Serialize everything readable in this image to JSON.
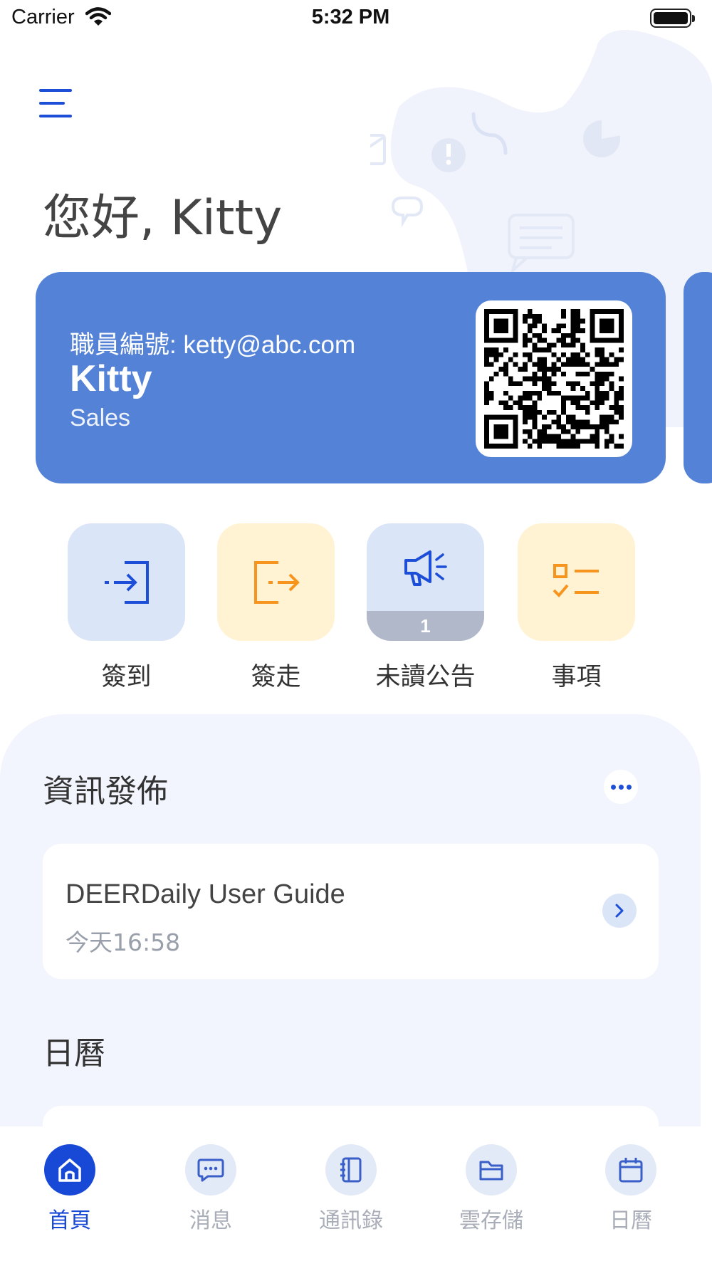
{
  "status_bar": {
    "carrier": "Carrier",
    "time": "5:32 PM"
  },
  "header": {
    "menu_icon": "menu-icon",
    "greeting": "您好, Kitty"
  },
  "id_card": {
    "employee_id": "職員編號: ketty@abc.com",
    "name": "Kitty",
    "department": "Sales",
    "qr_icon": "qr-code"
  },
  "quick_actions": [
    {
      "label": "簽到",
      "icon": "check-in-icon"
    },
    {
      "label": "簽走",
      "icon": "check-out-icon"
    },
    {
      "label": "未讀公告",
      "icon": "megaphone-icon",
      "badge": "1"
    },
    {
      "label": "事項",
      "icon": "checklist-icon"
    }
  ],
  "news_section": {
    "title": "資訊發佈",
    "items": [
      {
        "title": "DEERDaily User Guide",
        "time": "今天16:58"
      }
    ]
  },
  "calendar_section": {
    "title": "日曆"
  },
  "tabbar": {
    "items": [
      {
        "label": "首頁",
        "icon": "home-icon",
        "active": true
      },
      {
        "label": "消息",
        "icon": "chat-icon"
      },
      {
        "label": "通訊錄",
        "icon": "contacts-icon"
      },
      {
        "label": "雲存儲",
        "icon": "folder-icon"
      },
      {
        "label": "日曆",
        "icon": "calendar-icon"
      }
    ]
  },
  "colors": {
    "primary": "#1748d6",
    "card_blue": "#5482d7",
    "tile_blue": "#dbe5f8",
    "tile_yellow": "#fff3d4",
    "accent_orange": "#f7941d",
    "panel_bg": "#f2f5fd"
  }
}
